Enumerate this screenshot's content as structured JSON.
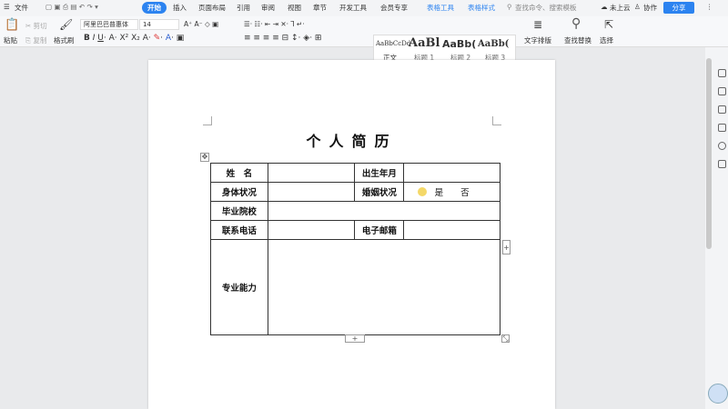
{
  "topbar": {
    "menu": "文件",
    "tabs": [
      "开始",
      "插入",
      "页面布局",
      "引用",
      "审阅",
      "视图",
      "章节",
      "开发工具",
      "会员专享",
      "表格工具",
      "表格样式"
    ],
    "search_placeholder": "查找命令、搜索模板",
    "cloud": "未上云",
    "collab": "协作",
    "share": "分享"
  },
  "ribbon": {
    "paste": "粘贴",
    "cut": "剪切",
    "copy": "复制",
    "format_painter": "格式刷",
    "font": "阿里巴巴普惠体",
    "size": "14",
    "styles": [
      {
        "preview": "AaBbCcDd",
        "label": "正文"
      },
      {
        "preview": "AaBl",
        "label": "标题 1"
      },
      {
        "preview": "AaBb(",
        "label": "标题 2"
      },
      {
        "preview": "AaBb(",
        "label": "标题 3"
      }
    ],
    "text_layout": "文字排版",
    "find_replace": "查找替换",
    "select": "选择"
  },
  "document": {
    "title": "个人简历",
    "rows": [
      [
        "姓　名",
        "",
        "出生年月",
        ""
      ],
      [
        "身体状况",
        "",
        "婚姻状况",
        "是　　否"
      ],
      [
        "毕业院校",
        ""
      ],
      [
        "联系电话",
        "",
        "电子邮箱",
        ""
      ],
      [
        "专业能力",
        ""
      ]
    ]
  }
}
